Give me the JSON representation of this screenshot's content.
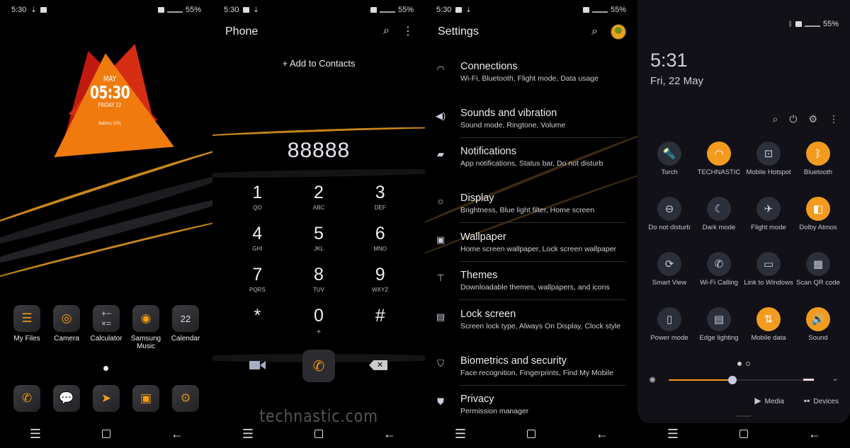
{
  "status_bar": {
    "time": "5:30",
    "battery": "55%"
  },
  "home": {
    "widget": {
      "month": "MAY",
      "time": "05:30",
      "day": "FRIDAY 22",
      "battery": "Battery 55%"
    },
    "apps": [
      {
        "label": "My Files",
        "icon": "folder-icon"
      },
      {
        "label": "Camera",
        "icon": "camera-icon"
      },
      {
        "label": "Calculator",
        "icon": "calculator-icon"
      },
      {
        "label": "Samsung Music",
        "icon": "music-record-icon"
      },
      {
        "label": "Calendar",
        "icon": "calendar-icon",
        "badge": "22"
      }
    ],
    "dock": [
      {
        "icon": "phone-icon"
      },
      {
        "icon": "messages-icon"
      },
      {
        "icon": "browser-cursor-icon"
      },
      {
        "icon": "gallery-frame-icon"
      },
      {
        "icon": "settings-gears-icon"
      }
    ]
  },
  "phone": {
    "title": "Phone",
    "add_contacts": "+ Add to Contacts",
    "dialed_number": "88888",
    "keys": [
      {
        "digit": "1",
        "letters": "QO"
      },
      {
        "digit": "2",
        "letters": "ABC"
      },
      {
        "digit": "3",
        "letters": "DEF"
      },
      {
        "digit": "4",
        "letters": "GHI"
      },
      {
        "digit": "5",
        "letters": "JKL"
      },
      {
        "digit": "6",
        "letters": "MNO"
      },
      {
        "digit": "7",
        "letters": "PQRS"
      },
      {
        "digit": "8",
        "letters": "TUV"
      },
      {
        "digit": "9",
        "letters": "WXYZ"
      },
      {
        "digit": "*",
        "letters": ""
      },
      {
        "digit": "0",
        "letters": "+"
      },
      {
        "digit": "#",
        "letters": ""
      }
    ],
    "backspace_glyph": "✕",
    "watermark": "technastic.com"
  },
  "settings": {
    "title": "Settings",
    "items": [
      {
        "title": "Connections",
        "subtitle": "Wi-Fi, Bluetooth, Flight mode, Data usage",
        "icon": "wifi-icon"
      },
      {
        "title": "Sounds and vibration",
        "subtitle": "Sound mode, Ringtone, Volume",
        "icon": "volume-icon"
      },
      {
        "title": "Notifications",
        "subtitle": "App notifications, Status bar, Do not disturb",
        "icon": "notifications-icon"
      },
      {
        "title": "Display",
        "subtitle": "Brightness, Blue light filter, Home screen",
        "icon": "brightness-icon"
      },
      {
        "title": "Wallpaper",
        "subtitle": "Home screen wallpaper, Lock screen wallpaper",
        "icon": "wallpaper-icon"
      },
      {
        "title": "Themes",
        "subtitle": "Downloadable themes, wallpapers, and icons",
        "icon": "themes-brush-icon"
      },
      {
        "title": "Lock screen",
        "subtitle": "Screen lock type, Always On Display, Clock style",
        "icon": "lock-screen-icon"
      },
      {
        "title": "Biometrics and security",
        "subtitle": "Face recognition, Fingerprints, Find My Mobile",
        "icon": "shield-icon"
      },
      {
        "title": "Privacy",
        "subtitle": "Permission manager",
        "icon": "privacy-shield-icon"
      }
    ]
  },
  "quick_settings": {
    "time": "5:31",
    "date": "Fri, 22 May",
    "tiles": [
      {
        "label": "Torch",
        "on": false,
        "glyph": "🔦",
        "icon": "torch-icon"
      },
      {
        "label": "TECHNASTIC",
        "on": true,
        "glyph": "◠",
        "icon": "wifi-icon"
      },
      {
        "label": "Mobile Hotspot",
        "on": false,
        "glyph": "⊡",
        "icon": "hotspot-icon"
      },
      {
        "label": "Bluetooth",
        "on": true,
        "glyph": "ᛒ",
        "icon": "bluetooth-icon"
      },
      {
        "label": "Do not disturb",
        "on": false,
        "glyph": "⊖",
        "icon": "do-not-disturb-icon"
      },
      {
        "label": "Dark mode",
        "on": false,
        "glyph": "☾",
        "icon": "dark-mode-icon"
      },
      {
        "label": "Flight mode",
        "on": false,
        "glyph": "✈",
        "icon": "airplane-icon"
      },
      {
        "label": "Dolby Atmos",
        "on": true,
        "glyph": "◧",
        "icon": "dolby-icon"
      },
      {
        "label": "Smart View",
        "on": false,
        "glyph": "⟳",
        "icon": "smart-view-icon"
      },
      {
        "label": "Wi-Fi Calling",
        "on": false,
        "glyph": "✆",
        "icon": "wifi-calling-icon"
      },
      {
        "label": "Link to Windows",
        "on": false,
        "glyph": "▭",
        "icon": "link-to-windows-icon"
      },
      {
        "label": "Scan QR code",
        "on": false,
        "glyph": "▦",
        "icon": "qr-code-icon"
      },
      {
        "label": "Power mode",
        "on": false,
        "glyph": "▯",
        "icon": "power-mode-icon"
      },
      {
        "label": "Edge lighting",
        "on": false,
        "glyph": "▤",
        "icon": "edge-lighting-icon"
      },
      {
        "label": "Mobile data",
        "on": true,
        "glyph": "⇅",
        "icon": "mobile-data-icon"
      },
      {
        "label": "Sound",
        "on": true,
        "glyph": "🔊",
        "icon": "sound-icon"
      }
    ],
    "brightness_percent": 44,
    "media_label": "Media",
    "devices_label": "Devices",
    "accent_color": "#f39b1f"
  }
}
